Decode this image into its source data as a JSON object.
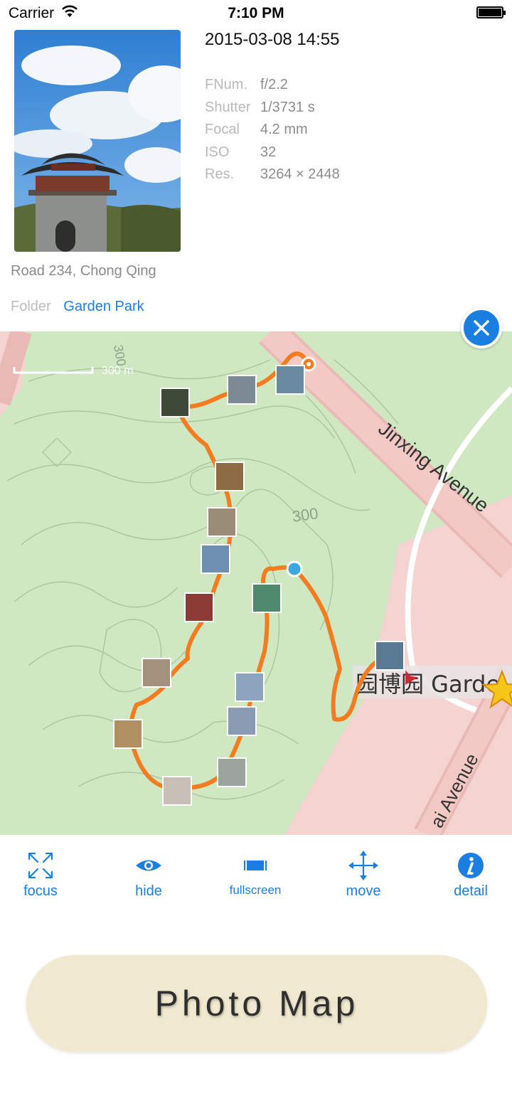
{
  "status": {
    "carrier": "Carrier",
    "time": "7:10 PM"
  },
  "photo": {
    "datetime": "2015-03-08 14:55",
    "exif": [
      {
        "key": "FNum.",
        "value": "f/2.2"
      },
      {
        "key": "Shutter",
        "value": "1/3731 s"
      },
      {
        "key": "Focal",
        "value": "4.2 mm"
      },
      {
        "key": "ISO",
        "value": "32"
      },
      {
        "key": "Res.",
        "value": "3264 × 2448"
      }
    ],
    "address": "Road 234, Chong Qing",
    "folder_label": "Folder",
    "folder_name": "Garden Park"
  },
  "map": {
    "scale_label": "300 m",
    "street_1": "Jinxing Avenue",
    "street_2": "ai Avenue",
    "contour_label": "300",
    "contour_label_2": "300",
    "poi_label": "园博园 Garde"
  },
  "toolbar": {
    "focus": "focus",
    "hide": "hide",
    "fullscreen": "fullscreen",
    "move": "move",
    "detail": "detail"
  },
  "promo": {
    "label": "Photo Map"
  },
  "colors": {
    "accent": "#1a7fe0",
    "route": "#f47b20",
    "map_green": "#cfe8c2",
    "promo_bg": "#f1e9cf"
  }
}
